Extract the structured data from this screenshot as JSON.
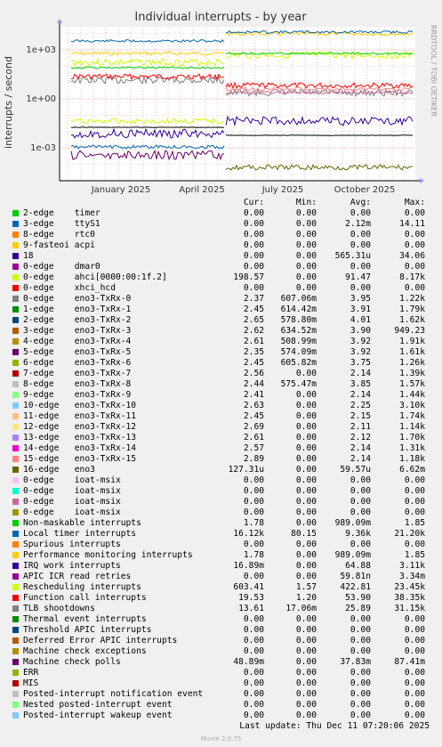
{
  "title": "Individual interrupts - by year",
  "ylabel": "interrupts / second",
  "side_text": "RRDTOOL / TOBI OETIKER",
  "columns": {
    "cur": "Cur:",
    "min": "Min:",
    "avg": "Avg:",
    "max": "Max:"
  },
  "last_update": "Last update: Thu Dec 11 07:20:06 2025",
  "version": "Munin 2.0.75",
  "chart_data": {
    "type": "line",
    "title": "Individual interrupts - by year",
    "ylabel": "interrupts / second",
    "yscale": "log",
    "yticks": [
      {
        "label": "1e+03",
        "value": 1000
      },
      {
        "label": "1e+00",
        "value": 1
      },
      {
        "label": "1e-03",
        "value": 0.001
      }
    ],
    "xticks": [
      "January 2025",
      "April 2025",
      "July 2025",
      "October 2025"
    ],
    "grid": true
  },
  "legend": [
    {
      "irq": "2-edge",
      "dev": "timer",
      "color": "#00cc00",
      "cur": "0.00",
      "min": "0.00",
      "avg": "0.00",
      "max": "0.00"
    },
    {
      "irq": "3-edge",
      "dev": "ttyS1",
      "color": "#0066b3",
      "cur": "0.00",
      "min": "0.00",
      "avg": "2.12m",
      "max": "14.11"
    },
    {
      "irq": "8-edge",
      "dev": "rtc0",
      "color": "#ff8000",
      "cur": "0.00",
      "min": "0.00",
      "avg": "0.00",
      "max": "0.00"
    },
    {
      "irq": "9-fasteoi",
      "dev": "acpi",
      "color": "#ffcc00",
      "cur": "0.00",
      "min": "0.00",
      "avg": "0.00",
      "max": "0.00"
    },
    {
      "irq": "18",
      "dev": "",
      "color": "#330099",
      "cur": "0.00",
      "min": "0.00",
      "avg": "565.31u",
      "max": "34.06"
    },
    {
      "irq": "0-edge",
      "dev": "dmar0",
      "color": "#990099",
      "cur": "0.00",
      "min": "0.00",
      "avg": "0.00",
      "max": "0.00"
    },
    {
      "irq": "0-edge",
      "dev": "ahci[0000:00:1f.2]",
      "color": "#ccff00",
      "cur": "198.57",
      "min": "0.00",
      "avg": "91.47",
      "max": "8.17k"
    },
    {
      "irq": "0-edge",
      "dev": "xhci_hcd",
      "color": "#ff0000",
      "cur": "0.00",
      "min": "0.00",
      "avg": "0.00",
      "max": "0.00"
    },
    {
      "irq": "0-edge",
      "dev": "eno3-TxRx-0",
      "color": "#808080",
      "cur": "2.37",
      "min": "607.06m",
      "avg": "3.95",
      "max": "1.22k"
    },
    {
      "irq": "1-edge",
      "dev": "eno3-TxRx-1",
      "color": "#008f00",
      "cur": "2.45",
      "min": "614.42m",
      "avg": "3.91",
      "max": "1.79k"
    },
    {
      "irq": "2-edge",
      "dev": "eno3-TxRx-2",
      "color": "#00487d",
      "cur": "2.65",
      "min": "578.80m",
      "avg": "4.01",
      "max": "1.62k"
    },
    {
      "irq": "3-edge",
      "dev": "eno3-TxRx-3",
      "color": "#b35a00",
      "cur": "2.62",
      "min": "634.52m",
      "avg": "3.90",
      "max": "949.23"
    },
    {
      "irq": "4-edge",
      "dev": "eno3-TxRx-4",
      "color": "#b38f00",
      "cur": "2.61",
      "min": "508.99m",
      "avg": "3.92",
      "max": "1.91k"
    },
    {
      "irq": "5-edge",
      "dev": "eno3-TxRx-5",
      "color": "#6b006b",
      "cur": "2.35",
      "min": "574.09m",
      "avg": "3.92",
      "max": "1.61k"
    },
    {
      "irq": "6-edge",
      "dev": "eno3-TxRx-6",
      "color": "#8fb300",
      "cur": "2.45",
      "min": "605.82m",
      "avg": "3.75",
      "max": "1.26k"
    },
    {
      "irq": "7-edge",
      "dev": "eno3-TxRx-7",
      "color": "#b30000",
      "cur": "2.56",
      "min": "0.00",
      "avg": "2.14",
      "max": "1.39k"
    },
    {
      "irq": "8-edge",
      "dev": "eno3-TxRx-8",
      "color": "#bebebe",
      "cur": "2.44",
      "min": "575.47m",
      "avg": "3.85",
      "max": "1.57k"
    },
    {
      "irq": "9-edge",
      "dev": "eno3-TxRx-9",
      "color": "#80ff80",
      "cur": "2.41",
      "min": "0.00",
      "avg": "2.14",
      "max": "1.44k"
    },
    {
      "irq": "10-edge",
      "dev": "eno3-TxRx-10",
      "color": "#80c9ff",
      "cur": "2.63",
      "min": "0.00",
      "avg": "2.25",
      "max": "3.10k"
    },
    {
      "irq": "11-edge",
      "dev": "eno3-TxRx-11",
      "color": "#ffc080",
      "cur": "2.45",
      "min": "0.00",
      "avg": "2.15",
      "max": "1.74k"
    },
    {
      "irq": "12-edge",
      "dev": "eno3-TxRx-12",
      "color": "#ffe680",
      "cur": "2.69",
      "min": "0.00",
      "avg": "2.11",
      "max": "1.14k"
    },
    {
      "irq": "13-edge",
      "dev": "eno3-TxRx-13",
      "color": "#aa80ff",
      "cur": "2.61",
      "min": "0.00",
      "avg": "2.12",
      "max": "1.70k"
    },
    {
      "irq": "14-edge",
      "dev": "eno3-TxRx-14",
      "color": "#ee00cc",
      "cur": "2.57",
      "min": "0.00",
      "avg": "2.14",
      "max": "1.31k"
    },
    {
      "irq": "15-edge",
      "dev": "eno3-TxRx-15",
      "color": "#ff8080",
      "cur": "2.89",
      "min": "0.00",
      "avg": "2.14",
      "max": "1.18k"
    },
    {
      "irq": "16-edge",
      "dev": "eno3",
      "color": "#666600",
      "cur": "127.31u",
      "min": "0.00",
      "avg": "59.57u",
      "max": "6.62m"
    },
    {
      "irq": "0-edge",
      "dev": "ioat-msix",
      "color": "#ffbfff",
      "cur": "0.00",
      "min": "0.00",
      "avg": "0.00",
      "max": "0.00"
    },
    {
      "irq": "0-edge",
      "dev": "ioat-msix",
      "color": "#00ffcc",
      "cur": "0.00",
      "min": "0.00",
      "avg": "0.00",
      "max": "0.00"
    },
    {
      "irq": "0-edge",
      "dev": "ioat-msix",
      "color": "#cc6699",
      "cur": "0.00",
      "min": "0.00",
      "avg": "0.00",
      "max": "0.00"
    },
    {
      "irq": "0-edge",
      "dev": "ioat-msix",
      "color": "#999900",
      "cur": "0.00",
      "min": "0.00",
      "avg": "0.00",
      "max": "0.00"
    },
    {
      "irq": "Non-maskable interrupts",
      "dev": "",
      "color": "#00cc00",
      "cur": "1.78",
      "min": "0.00",
      "avg": "989.09m",
      "max": "1.85"
    },
    {
      "irq": "Local timer interrupts",
      "dev": "",
      "color": "#0066b3",
      "cur": "16.12k",
      "min": "80.15",
      "avg": "9.36k",
      "max": "21.20k"
    },
    {
      "irq": "Spurious interrupts",
      "dev": "",
      "color": "#ff8000",
      "cur": "0.00",
      "min": "0.00",
      "avg": "0.00",
      "max": "0.00"
    },
    {
      "irq": "Performance monitoring interrupts",
      "dev": "",
      "color": "#ffcc00",
      "cur": "1.78",
      "min": "0.00",
      "avg": "989.09m",
      "max": "1.85"
    },
    {
      "irq": "IRQ work interrupts",
      "dev": "",
      "color": "#330099",
      "cur": "16.89m",
      "min": "0.00",
      "avg": "64.88",
      "max": "3.11k"
    },
    {
      "irq": "APIC ICR read retries",
      "dev": "",
      "color": "#990099",
      "cur": "0.00",
      "min": "0.00",
      "avg": "59.81n",
      "max": "3.34m"
    },
    {
      "irq": "Rescheduling interrupts",
      "dev": "",
      "color": "#ccff00",
      "cur": "603.41",
      "min": "1.57",
      "avg": "422.81",
      "max": "23.45k"
    },
    {
      "irq": "Function call interrupts",
      "dev": "",
      "color": "#ff0000",
      "cur": "19.53",
      "min": "1.20",
      "avg": "53.90",
      "max": "38.35k"
    },
    {
      "irq": "TLB shootdowns",
      "dev": "",
      "color": "#808080",
      "cur": "13.61",
      "min": "17.06m",
      "avg": "25.89",
      "max": "31.15k"
    },
    {
      "irq": "Thermal event interrupts",
      "dev": "",
      "color": "#008f00",
      "cur": "0.00",
      "min": "0.00",
      "avg": "0.00",
      "max": "0.00"
    },
    {
      "irq": "Threshold APIC interrupts",
      "dev": "",
      "color": "#00487d",
      "cur": "0.00",
      "min": "0.00",
      "avg": "0.00",
      "max": "0.00"
    },
    {
      "irq": "Deferred Error APIC interrupts",
      "dev": "",
      "color": "#b35a00",
      "cur": "0.00",
      "min": "0.00",
      "avg": "0.00",
      "max": "0.00"
    },
    {
      "irq": "Machine check exceptions",
      "dev": "",
      "color": "#b38f00",
      "cur": "0.00",
      "min": "0.00",
      "avg": "0.00",
      "max": "0.00"
    },
    {
      "irq": "Machine check polls",
      "dev": "",
      "color": "#6b006b",
      "cur": "48.89m",
      "min": "0.00",
      "avg": "37.83m",
      "max": "87.41m"
    },
    {
      "irq": "ERR",
      "dev": "",
      "color": "#8fb300",
      "cur": "0.00",
      "min": "0.00",
      "avg": "0.00",
      "max": "0.00"
    },
    {
      "irq": "MIS",
      "dev": "",
      "color": "#b30000",
      "cur": "0.00",
      "min": "0.00",
      "avg": "0.00",
      "max": "0.00"
    },
    {
      "irq": "Posted-interrupt notification event",
      "dev": "",
      "color": "#bebebe",
      "cur": "0.00",
      "min": "0.00",
      "avg": "0.00",
      "max": "0.00"
    },
    {
      "irq": "Nested posted-interrupt event",
      "dev": "",
      "color": "#80ff80",
      "cur": "0.00",
      "min": "0.00",
      "avg": "0.00",
      "max": "0.00"
    },
    {
      "irq": "Posted-interrupt wakeup event",
      "dev": "",
      "color": "#80c9ff",
      "cur": "0.00",
      "min": "0.00",
      "avg": "0.00",
      "max": "0.00"
    }
  ]
}
